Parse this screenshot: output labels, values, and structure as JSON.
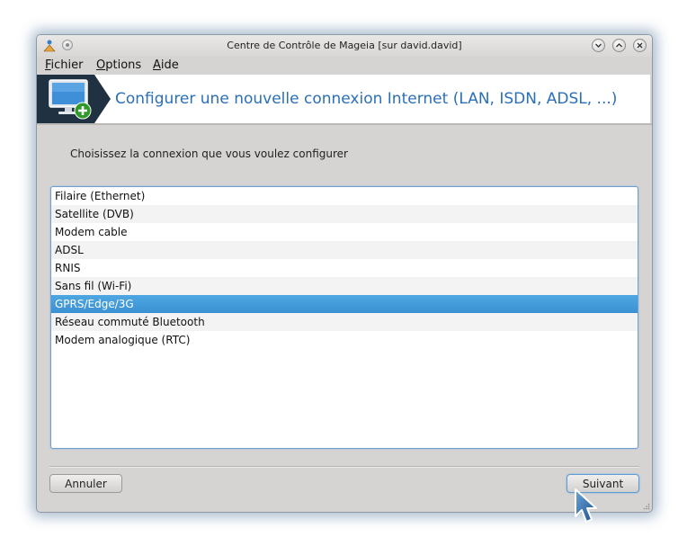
{
  "window": {
    "title": "Centre de Contrôle de Mageia  [sur david.david]"
  },
  "menu": [
    {
      "label": "Fichier",
      "mnemonic": "F"
    },
    {
      "label": "Options",
      "mnemonic": "O"
    },
    {
      "label": "Aide",
      "mnemonic": "A"
    }
  ],
  "header": {
    "title": "Configurer une nouvelle connexion Internet (LAN, ISDN, ADSL, ...)",
    "icon": "monitor-plus-icon"
  },
  "prompt": "Choisissez la connexion que vous voulez configurer",
  "connections": {
    "items": [
      "Filaire (Ethernet)",
      "Satellite (DVB)",
      "Modem cable",
      "ADSL",
      "RNIS",
      "Sans fil (Wi-Fi)",
      "GPRS/Edge/3G",
      "Réseau commuté Bluetooth",
      "Modem analogique (RTC)"
    ],
    "selected": "GPRS/Edge/3G"
  },
  "buttons": {
    "cancel": "Annuler",
    "next": "Suivant"
  },
  "colors": {
    "accent": "#2b6fb7",
    "selection": "#3b90d2",
    "window_bg": "#d6d4d2"
  }
}
